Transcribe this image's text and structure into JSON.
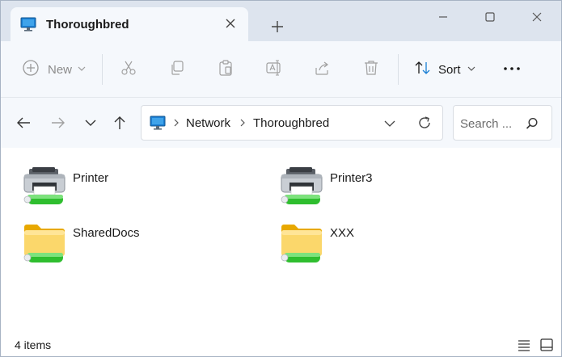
{
  "window": {
    "tab_title": "Thoroughbred",
    "tab_icon": "computer-monitor-icon",
    "accent": "#1a7fd4"
  },
  "toolbar": {
    "new_label": "New",
    "sort_label": "Sort"
  },
  "address": {
    "crumbs": [
      "Network",
      "Thoroughbred"
    ]
  },
  "search": {
    "placeholder": "Search ..."
  },
  "items": [
    {
      "label": "Printer",
      "icon": "printer-icon"
    },
    {
      "label": "Printer3",
      "icon": "printer-icon"
    },
    {
      "label": "SharedDocs",
      "icon": "folder-icon"
    },
    {
      "label": "XXX",
      "icon": "folder-icon"
    }
  ],
  "status": {
    "count": "4 items"
  }
}
